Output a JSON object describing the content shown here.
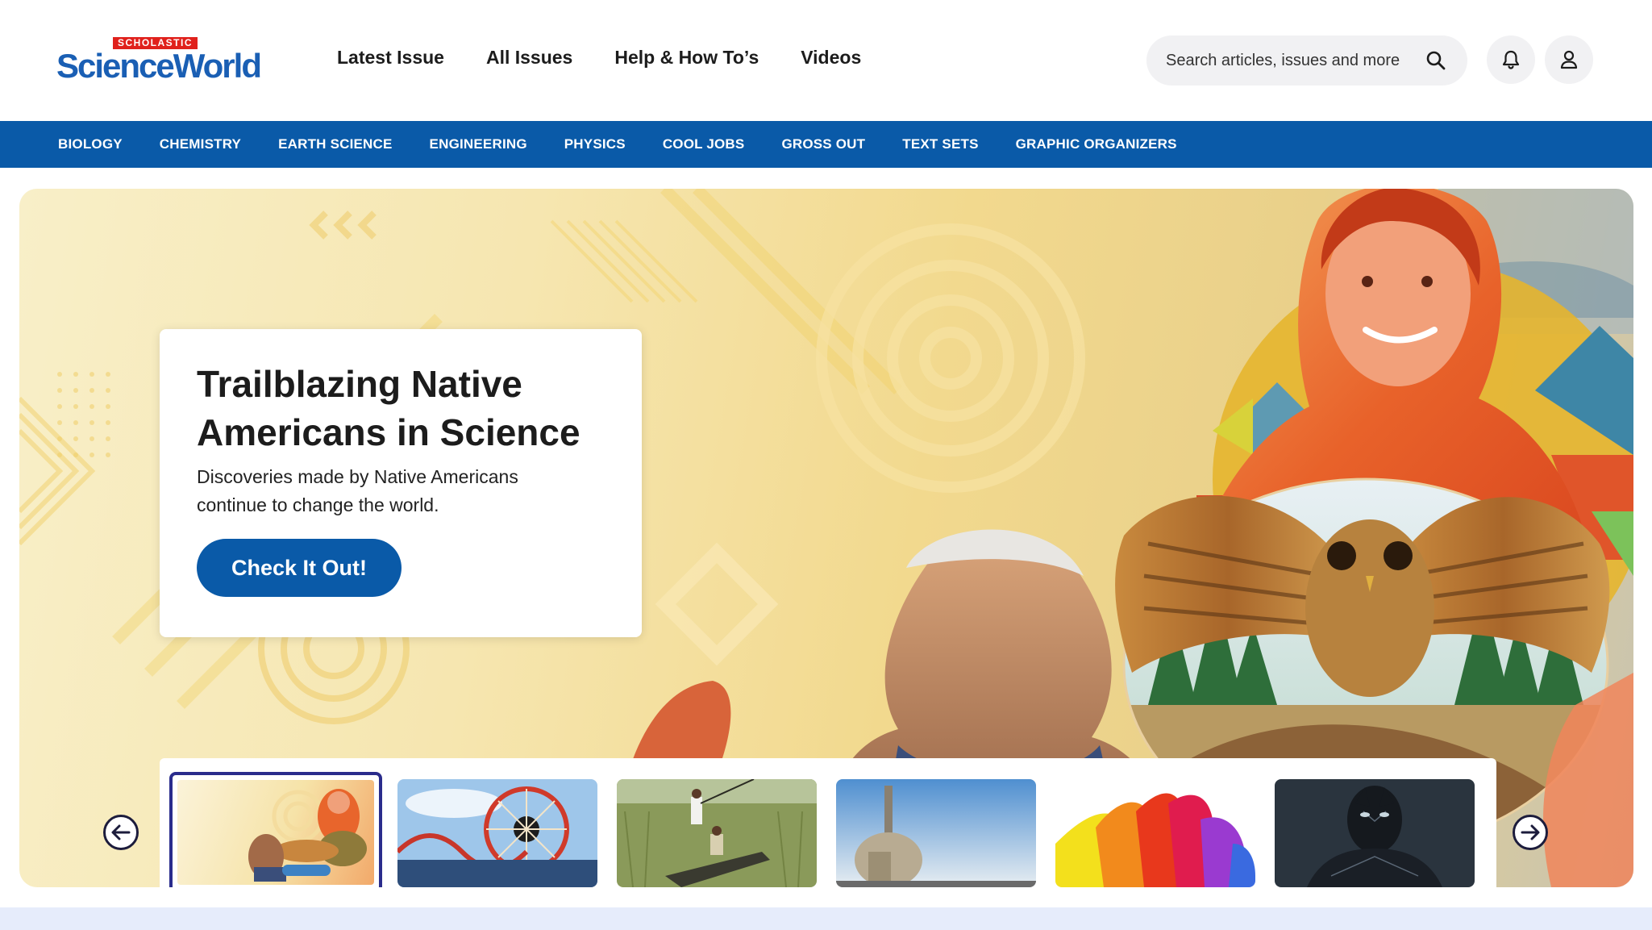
{
  "header": {
    "logo_brand_top": "SCHOLASTIC",
    "logo_brand_main": "ScienceWorld",
    "nav": [
      "Latest Issue",
      "All Issues",
      "Help & How To’s",
      "Videos"
    ],
    "search": {
      "placeholder": "Search articles, issues and more"
    },
    "icons": {
      "search": "search-icon",
      "bell": "bell-icon",
      "user": "user-icon"
    }
  },
  "categories": [
    "BIOLOGY",
    "CHEMISTRY",
    "EARTH SCIENCE",
    "ENGINEERING",
    "PHYSICS",
    "COOL JOBS",
    "GROSS OUT",
    "TEXT SETS",
    "GRAPHIC ORGANIZERS"
  ],
  "hero": {
    "title": "Trailblazing Native Americans in Science",
    "description": "Discoveries made by Native Americans continue to change the world.",
    "cta": "Check It Out!"
  },
  "carousel": {
    "prev_icon": "arrow-left-icon",
    "next_icon": "arrow-right-icon",
    "active_index": 0,
    "thumbnails": [
      "native-americans-collage",
      "amusement-park-ferris-wheel",
      "boat-in-marsh",
      "telescope-dish",
      "colorful-shoes",
      "black-panther-figure"
    ]
  },
  "colors": {
    "brand_blue": "#0a5aa8",
    "brand_red": "#e0211c",
    "active_border": "#2a2c8c",
    "bottom_band": "#e6ecfb"
  }
}
